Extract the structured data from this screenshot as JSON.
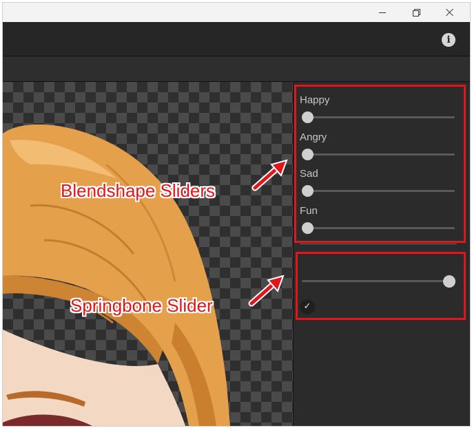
{
  "window": {
    "controls": [
      "minimize",
      "maximize",
      "close"
    ]
  },
  "toolbar": {
    "info_icon": "i"
  },
  "panel": {
    "blendshapes": [
      {
        "label": "Happy",
        "value": 0
      },
      {
        "label": "Angry",
        "value": 0
      },
      {
        "label": "Sad",
        "value": 0
      },
      {
        "label": "Fun",
        "value": 0
      }
    ],
    "springbone": {
      "value": 1.0,
      "checkbox_checked": true,
      "checkbox_glyph": "✓"
    }
  },
  "annotations": {
    "blendshape": "Blendshape Sliders",
    "springbone": "Springbone Slider",
    "color": "#e0161c"
  }
}
